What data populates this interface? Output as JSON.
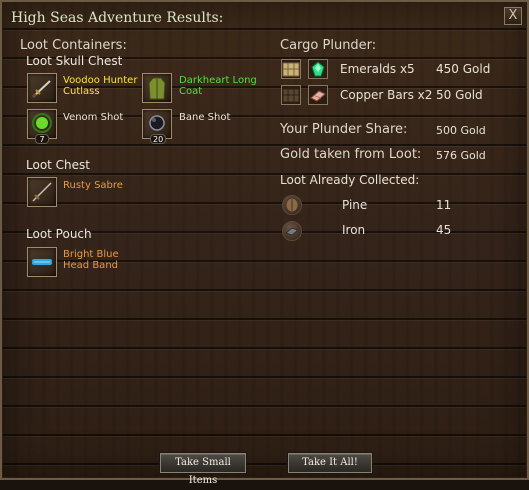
{
  "window": {
    "title": "High Seas Adventure Results:",
    "close_label": "X"
  },
  "loot": {
    "heading": "Loot Containers:",
    "skull_chest": {
      "title": "Loot Skull Chest",
      "items": [
        {
          "name": "Voodoo Hunter Cutlass",
          "icon": "cutlass-icon",
          "color": "#ffe23a"
        },
        {
          "name": "Darkheart Long Coat",
          "icon": "coat-icon",
          "color": "#4fe03a"
        },
        {
          "name": "Venom Shot",
          "icon": "venom-shot-icon",
          "qty": "7",
          "color": "#ece6da"
        },
        {
          "name": "Bane Shot",
          "icon": "bane-shot-icon",
          "qty": "20",
          "color": "#ece6da"
        }
      ]
    },
    "chest": {
      "title": "Loot Chest",
      "items": [
        {
          "name": "Rusty Sabre",
          "icon": "sabre-icon",
          "color": "#e79a42"
        }
      ]
    },
    "pouch": {
      "title": "Loot Pouch",
      "items": [
        {
          "name": "Bright Blue Head Band",
          "icon": "headband-icon",
          "color": "#e79a42"
        }
      ]
    }
  },
  "cargo": {
    "heading": "Cargo Plunder:",
    "rows": [
      {
        "name": "Emeralds x5",
        "value": "450 Gold",
        "icons": [
          "crate-icon",
          "emerald-icon"
        ]
      },
      {
        "name": "Copper Bars x2",
        "value": "50 Gold",
        "icons": [
          "crate-icon",
          "copper-bar-icon"
        ]
      }
    ]
  },
  "summary": {
    "plunder_share_label": "Your Plunder Share:",
    "plunder_share_value": "500 Gold",
    "gold_taken_label": "Gold taken from Loot:",
    "gold_taken_value": "576 Gold"
  },
  "collected": {
    "heading": "Loot Already Collected:",
    "rows": [
      {
        "name": "Pine",
        "value": "11",
        "icon": "pine-icon"
      },
      {
        "name": "Iron",
        "value": "45",
        "icon": "iron-icon"
      }
    ]
  },
  "buttons": {
    "take_small": "Take Small Items",
    "take_all": "Take It All!"
  }
}
